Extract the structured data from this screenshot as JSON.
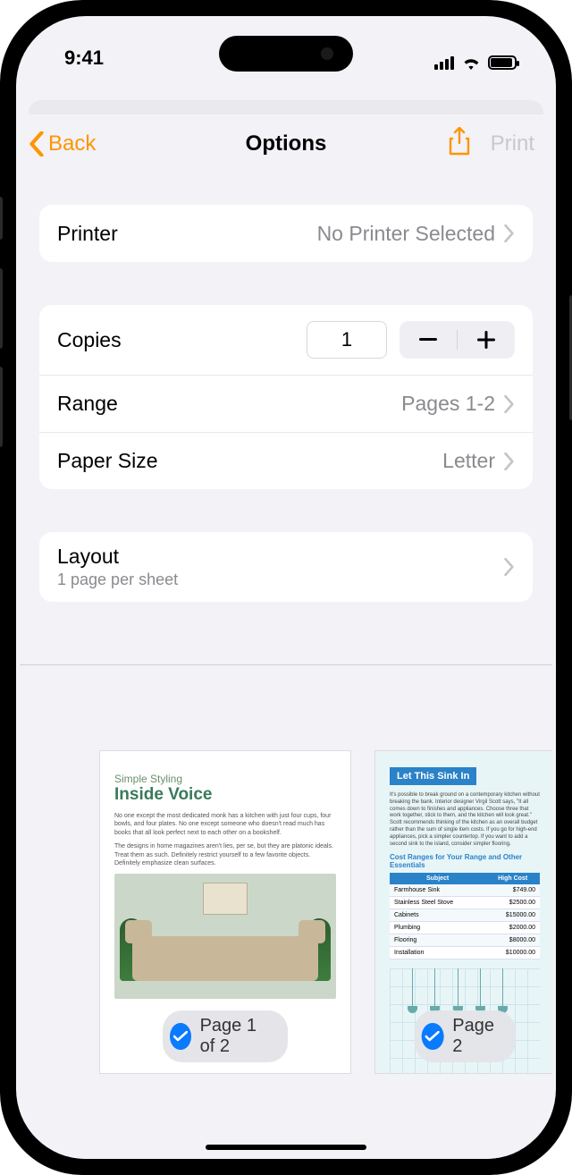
{
  "status": {
    "time": "9:41"
  },
  "nav": {
    "back": "Back",
    "title": "Options",
    "print": "Print"
  },
  "printer_group": {
    "label": "Printer",
    "value": "No Printer Selected"
  },
  "settings_group": {
    "copies": {
      "label": "Copies",
      "value": "1"
    },
    "range": {
      "label": "Range",
      "value": "Pages 1-2"
    },
    "paper": {
      "label": "Paper Size",
      "value": "Letter"
    }
  },
  "layout_group": {
    "label": "Layout",
    "subtitle": "1 page per sheet"
  },
  "preview": {
    "page1": {
      "pill": "Page 1 of 2",
      "subhead": "Simple Styling",
      "title": "Inside Voice",
      "para1": "No one except the most dedicated monk has a kitchen with just four cups, four bowls, and four plates. No one except someone who doesn't read much has books that all look perfect next to each other on a bookshelf.",
      "para2": "The designs in home magazines aren't lies, per se, but they are platonic ideals. Treat them as such. Definitely restrict yourself to a few favorite objects. Definitely emphasize clean surfaces."
    },
    "page2": {
      "pill": "Page 2",
      "chip": "Let This Sink In",
      "intro": "It's possible to break ground on a contemporary kitchen without breaking the bank. Interior designer Virgil Scott says, \"It all comes down to finishes and appliances. Choose three that work together, stick to them, and the kitchen will look great.\" Scott recommends thinking of the kitchen as an overall budget rather than the sum of single item costs. If you go for high-end appliances, pick a simpler countertop. If you want to add a second sink to the island, consider simpler flooring.",
      "cost_heading": "Cost Ranges for Your Range and Other Essentials",
      "table": {
        "headers": [
          "Subject",
          "High Cost"
        ],
        "rows": [
          [
            "Farmhouse Sink",
            "$749.00"
          ],
          [
            "Stainless Steel Stove",
            "$2500.00"
          ],
          [
            "Cabinets",
            "$15000.00"
          ],
          [
            "Plumbing",
            "$2000.00"
          ],
          [
            "Flooring",
            "$8000.00"
          ],
          [
            "Installation",
            "$10000.00"
          ]
        ]
      }
    }
  }
}
